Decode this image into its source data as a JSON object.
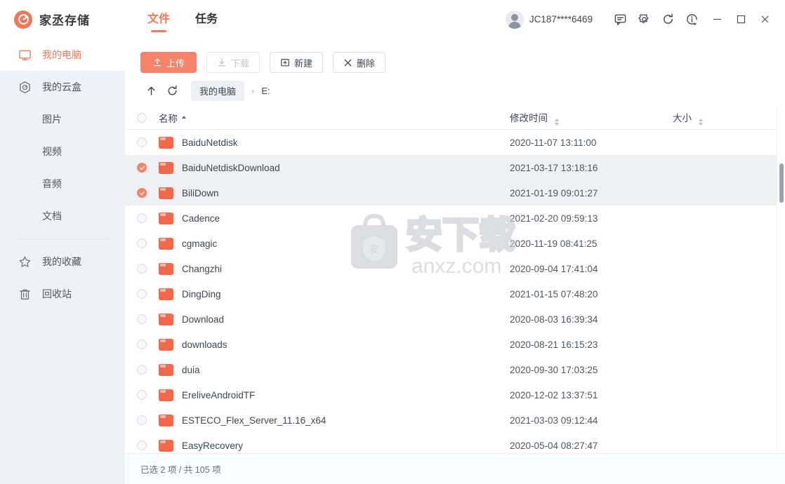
{
  "app": {
    "brand_name": "家丞存储",
    "logo_icon": "app-logo-icon"
  },
  "header": {
    "tabs": [
      {
        "label": "文件",
        "active": true
      },
      {
        "label": "任务",
        "active": false
      }
    ],
    "user_name": "JC187****6469",
    "icons": [
      {
        "name": "message-icon"
      },
      {
        "name": "gear-icon"
      },
      {
        "name": "refresh-icon"
      },
      {
        "name": "info-icon"
      }
    ],
    "window_controls": [
      {
        "name": "minimize-button",
        "glyph": "—"
      },
      {
        "name": "maximize-button",
        "glyph": "▢"
      },
      {
        "name": "close-button",
        "glyph": "✕"
      }
    ]
  },
  "sidebar": {
    "items": [
      {
        "label": "我的电脑",
        "icon": "monitor-icon",
        "active": true,
        "indent": false
      },
      {
        "label": "我的云盒",
        "icon": "cloudbox-icon",
        "active": false,
        "indent": false
      },
      {
        "label": "图片",
        "icon": "",
        "active": false,
        "indent": true
      },
      {
        "label": "视频",
        "icon": "",
        "active": false,
        "indent": true
      },
      {
        "label": "音频",
        "icon": "",
        "active": false,
        "indent": true
      },
      {
        "label": "文档",
        "icon": "",
        "active": false,
        "indent": true
      },
      {
        "label": "我的收藏",
        "icon": "star-icon",
        "active": false,
        "indent": false
      },
      {
        "label": "回收站",
        "icon": "trash-icon",
        "active": false,
        "indent": false
      }
    ]
  },
  "toolbar": {
    "upload_label": "上传",
    "download_label": "下载",
    "new_label": "新建",
    "delete_label": "删除"
  },
  "breadcrumb": {
    "up_icon": "arrow-up-icon",
    "refresh_icon": "refresh-icon",
    "root_label": "我的电脑",
    "separator": "›",
    "current_label": "E:"
  },
  "table": {
    "columns": {
      "name": "名称",
      "time": "修改时间",
      "size": "大小"
    },
    "sort": {
      "column": "名称",
      "direction": "asc"
    },
    "rows": [
      {
        "name": "BaiduNetdisk",
        "time": "2020-11-07 13:11:00",
        "size": "",
        "selected": false
      },
      {
        "name": "BaiduNetdiskDownload",
        "time": "2021-03-17 13:18:16",
        "size": "",
        "selected": true
      },
      {
        "name": "BiliDown",
        "time": "2021-01-19 09:01:27",
        "size": "",
        "selected": true
      },
      {
        "name": "Cadence",
        "time": "2021-02-20 09:59:13",
        "size": "",
        "selected": false
      },
      {
        "name": "cgmagic",
        "time": "2020-11-19 08:41:25",
        "size": "",
        "selected": false
      },
      {
        "name": "Changzhi",
        "time": "2020-09-04 17:41:04",
        "size": "",
        "selected": false
      },
      {
        "name": "DingDing",
        "time": "2021-01-15 07:48:20",
        "size": "",
        "selected": false
      },
      {
        "name": "Download",
        "time": "2020-08-03 16:39:34",
        "size": "",
        "selected": false
      },
      {
        "name": "downloads",
        "time": "2020-08-21 16:15:23",
        "size": "",
        "selected": false
      },
      {
        "name": "duia",
        "time": "2020-09-30 17:03:25",
        "size": "",
        "selected": false
      },
      {
        "name": "EreliveAndroidTF",
        "time": "2020-12-02 13:37:51",
        "size": "",
        "selected": false
      },
      {
        "name": "ESTECO_Flex_Server_11.16_x64",
        "time": "2021-03-03 09:12:44",
        "size": "",
        "selected": false
      },
      {
        "name": "EasyRecovery",
        "time": "2020-05-04 08:27:47",
        "size": "",
        "selected": false
      }
    ]
  },
  "watermark": {
    "text": "anxz.com",
    "cn_text": "安下载"
  },
  "status": {
    "text": "已选 2 项 / 共 105 项"
  },
  "colors": {
    "accent": "#f1765c",
    "accent_button": "#f4836a",
    "folder": "#f1694a",
    "sidebar_bg": "#eef1f6",
    "row_selected_bg": "#eef0f4"
  }
}
